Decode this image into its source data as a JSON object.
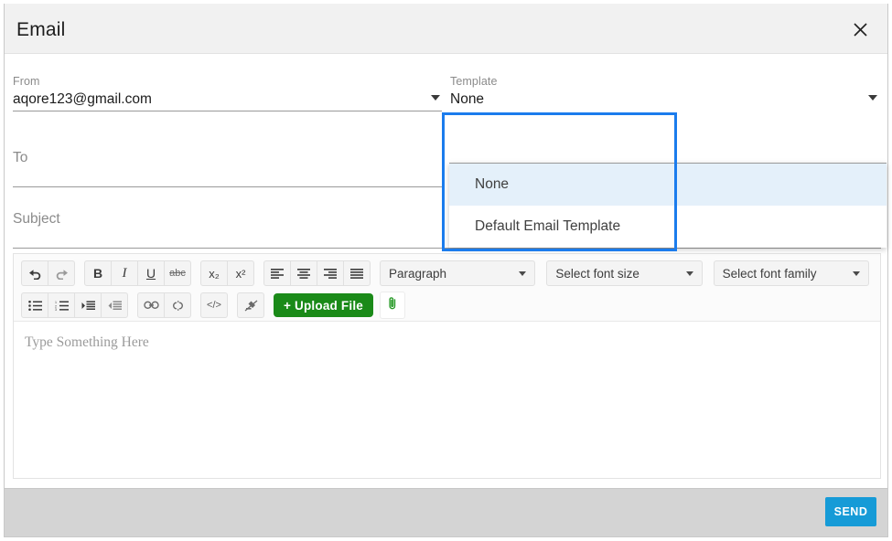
{
  "dialog": {
    "title": "Email",
    "close_icon": "close-icon"
  },
  "fields": {
    "from": {
      "label": "From",
      "value": "aqore123@gmail.com",
      "caret_icon": "chevron-down-icon"
    },
    "to": {
      "label": "To",
      "value": "",
      "placeholder": ""
    },
    "subject": {
      "label": "Subject",
      "value": "",
      "placeholder": ""
    },
    "template": {
      "label": "Template",
      "value": "None",
      "caret_icon": "chevron-down-icon"
    }
  },
  "template_dropdown": {
    "open": true,
    "highlight_color": "#e4f0fa",
    "focus_outline_color": "#1b7ced",
    "options": [
      {
        "label": "None",
        "selected": true
      },
      {
        "label": "Default Email Template",
        "selected": false
      }
    ]
  },
  "editor": {
    "placeholder": "Type Something Here",
    "toolbar": {
      "row1": {
        "history": [
          {
            "name": "undo-icon",
            "title": "Undo"
          },
          {
            "name": "redo-icon",
            "title": "Redo"
          }
        ],
        "formatting": [
          {
            "name": "bold-icon",
            "title": "Bold",
            "glyph": "B"
          },
          {
            "name": "italic-icon",
            "title": "Italic",
            "glyph": "I"
          },
          {
            "name": "underline-icon",
            "title": "Underline",
            "glyph": "U"
          },
          {
            "name": "strikethrough-icon",
            "title": "Strikethrough",
            "glyph": "abc"
          }
        ],
        "script": [
          {
            "name": "subscript-icon",
            "title": "Subscript",
            "glyph": "x₂"
          },
          {
            "name": "superscript-icon",
            "title": "Superscript",
            "glyph": "x²"
          }
        ],
        "align": [
          {
            "name": "align-left-icon",
            "title": "Align left"
          },
          {
            "name": "align-center-icon",
            "title": "Align center"
          },
          {
            "name": "align-right-icon",
            "title": "Align right"
          },
          {
            "name": "align-justify-icon",
            "title": "Justify"
          }
        ],
        "selects": [
          {
            "name": "paragraph-select",
            "value": "Paragraph"
          },
          {
            "name": "font-size-select",
            "value": "Select font size"
          },
          {
            "name": "font-family-select",
            "value": "Select font family"
          }
        ]
      },
      "row2": {
        "lists": [
          {
            "name": "unordered-list-icon",
            "title": "Bulleted list"
          },
          {
            "name": "ordered-list-icon",
            "title": "Numbered list"
          },
          {
            "name": "indent-icon",
            "title": "Increase indent"
          },
          {
            "name": "outdent-icon",
            "title": "Decrease indent"
          }
        ],
        "links": [
          {
            "name": "link-icon",
            "title": "Insert link"
          },
          {
            "name": "unlink-icon",
            "title": "Remove link"
          }
        ],
        "code": [
          {
            "name": "code-view-icon",
            "title": "Code view",
            "glyph": "</>"
          }
        ],
        "clear": [
          {
            "name": "remove-format-icon",
            "title": "Clear formatting"
          }
        ],
        "upload_label": "+ Upload File",
        "upload_color": "#1a8a18",
        "attach_icon": "paperclip-icon"
      }
    }
  },
  "footer": {
    "send_label": "SEND",
    "send_color": "#169bd7"
  }
}
